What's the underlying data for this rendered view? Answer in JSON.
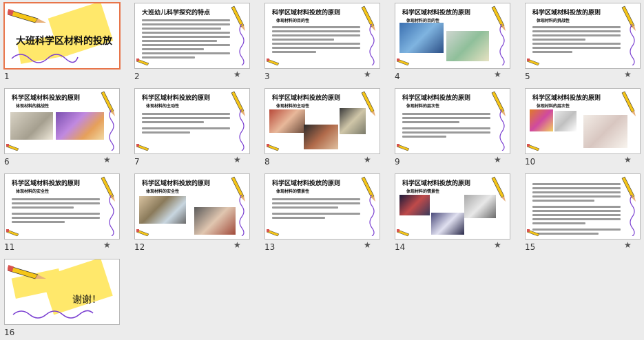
{
  "slides": [
    {
      "number": "1",
      "title": "大班科学区材料的投放",
      "subtitle": ""
    },
    {
      "number": "2",
      "title": "大班幼儿科学探究的特点",
      "subtitle": ""
    },
    {
      "number": "3",
      "title": "科学区域材料投放的原则",
      "subtitle": "体现材料的目的性"
    },
    {
      "number": "4",
      "title": "科学区域材料投放的原则",
      "subtitle": "体现材料的目的性"
    },
    {
      "number": "5",
      "title": "科学区域材料投放的原则",
      "subtitle": "体现材料的挑战性"
    },
    {
      "number": "6",
      "title": "科学区域材料投放的原则",
      "subtitle": "体现材料的挑战性"
    },
    {
      "number": "7",
      "title": "科学区域材料投放的原则",
      "subtitle": "体现材料的主动性"
    },
    {
      "number": "8",
      "title": "科学区域材料投放的原则",
      "subtitle": "体现材料的主动性"
    },
    {
      "number": "9",
      "title": "科学区域材料投放的原则",
      "subtitle": "体现材料的层次性"
    },
    {
      "number": "10",
      "title": "科学区域材料投放的原则",
      "subtitle": "体现材料的层次性"
    },
    {
      "number": "11",
      "title": "科学区域材料投放的原则",
      "subtitle": "体现材料的安全性"
    },
    {
      "number": "12",
      "title": "科学区域材料投放的原则",
      "subtitle": "体现材料的安全性"
    },
    {
      "number": "13",
      "title": "科学区域材料投放的原则",
      "subtitle": "体现材料的情景性"
    },
    {
      "number": "14",
      "title": "科学区域材料投放的原则",
      "subtitle": "体现材料的情景性"
    },
    {
      "number": "15",
      "title": "",
      "subtitle": ""
    },
    {
      "number": "16",
      "title": "谢谢！",
      "subtitle": ""
    }
  ],
  "star_icon": "star-icon",
  "colors": {
    "selected_border": "#e8754a",
    "cover_yellow": "#ffe86b",
    "pencil_yellow": "#f5c518",
    "wave_purple": "#7a3fd1"
  }
}
